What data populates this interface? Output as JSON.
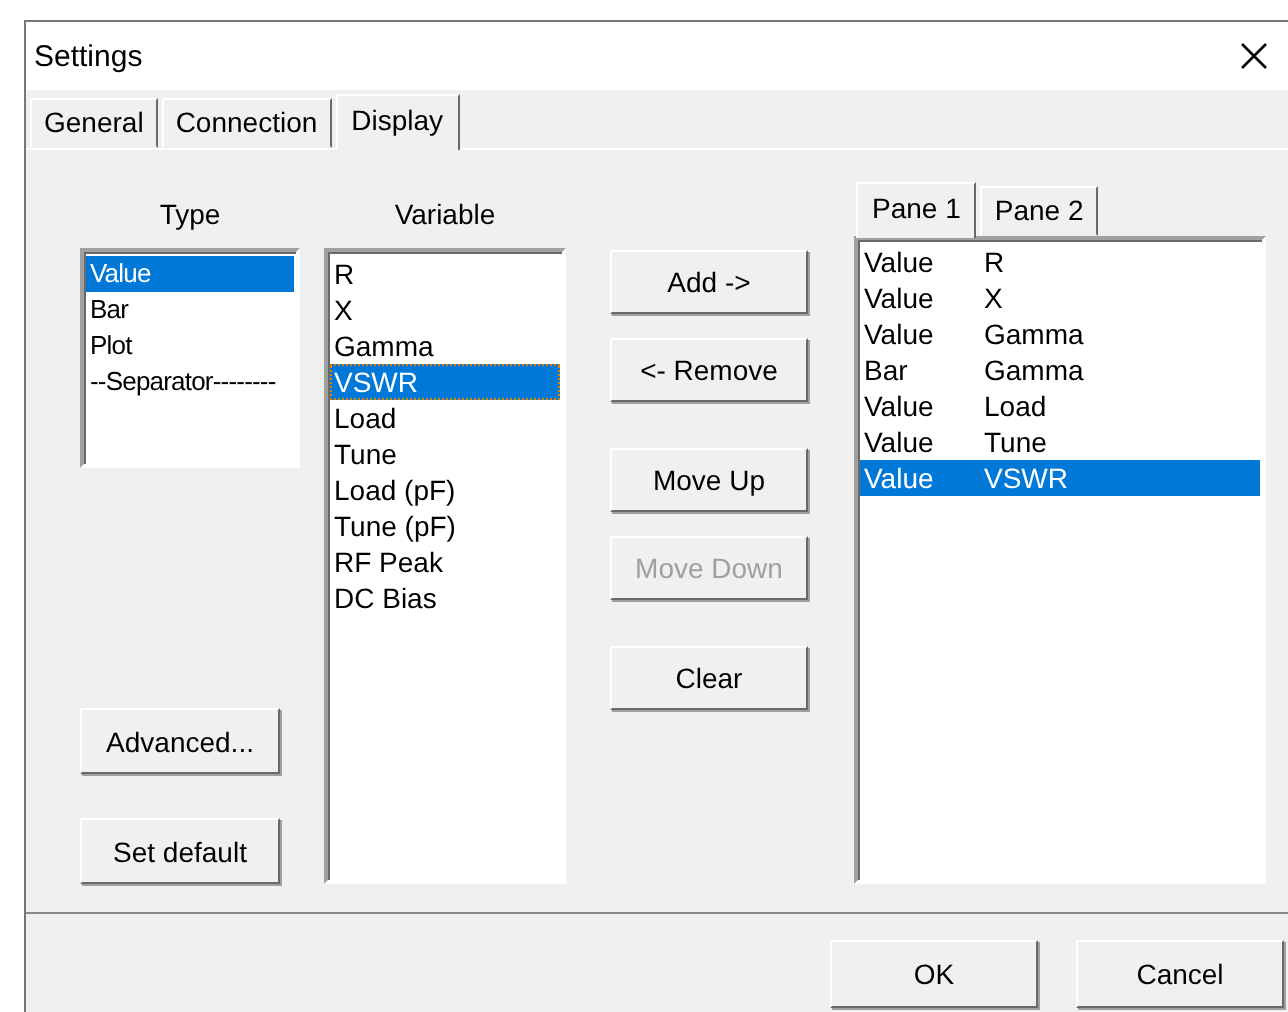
{
  "window": {
    "title": "Settings"
  },
  "tabs": [
    {
      "label": "General",
      "selected": false
    },
    {
      "label": "Connection",
      "selected": false
    },
    {
      "label": "Display",
      "selected": true
    }
  ],
  "type_list": {
    "label": "Type",
    "items": [
      {
        "text": "Value",
        "selected": true
      },
      {
        "text": "Bar",
        "selected": false
      },
      {
        "text": "Plot",
        "selected": false
      },
      {
        "text": "--Separator--------",
        "selected": false
      }
    ]
  },
  "variable_list": {
    "label": "Variable",
    "items": [
      {
        "text": "R",
        "selected": false,
        "focused": false
      },
      {
        "text": "X",
        "selected": false,
        "focused": false
      },
      {
        "text": "Gamma",
        "selected": false,
        "focused": false
      },
      {
        "text": "VSWR",
        "selected": true,
        "focused": true
      },
      {
        "text": "Load",
        "selected": false,
        "focused": false
      },
      {
        "text": "Tune",
        "selected": false,
        "focused": false
      },
      {
        "text": "Load (pF)",
        "selected": false,
        "focused": false
      },
      {
        "text": "Tune (pF)",
        "selected": false,
        "focused": false
      },
      {
        "text": "RF Peak",
        "selected": false,
        "focused": false
      },
      {
        "text": "DC Bias",
        "selected": false,
        "focused": false
      }
    ]
  },
  "left_buttons": [
    {
      "label": "Advanced...",
      "disabled": false
    },
    {
      "label": "Set default",
      "disabled": false
    }
  ],
  "action_buttons": [
    {
      "label": "Add ->",
      "disabled": false
    },
    {
      "label": "<- Remove",
      "disabled": false
    },
    {
      "label": "Move Up",
      "disabled": false
    },
    {
      "label": "Move Down",
      "disabled": true
    },
    {
      "label": "Clear",
      "disabled": false
    }
  ],
  "pane_tabs": [
    {
      "label": "Pane 1",
      "selected": true
    },
    {
      "label": "Pane 2",
      "selected": false
    }
  ],
  "pane_items": [
    {
      "type": "Value",
      "variable": "R",
      "selected": false
    },
    {
      "type": "Value",
      "variable": "X",
      "selected": false
    },
    {
      "type": "Value",
      "variable": "Gamma",
      "selected": false
    },
    {
      "type": "Bar",
      "variable": "Gamma",
      "selected": false
    },
    {
      "type": "Value",
      "variable": "Load",
      "selected": false
    },
    {
      "type": "Value",
      "variable": "Tune",
      "selected": false
    },
    {
      "type": "Value",
      "variable": "VSWR",
      "selected": true
    }
  ],
  "footer_buttons": [
    {
      "label": "OK",
      "disabled": false
    },
    {
      "label": "Cancel",
      "disabled": false
    }
  ]
}
